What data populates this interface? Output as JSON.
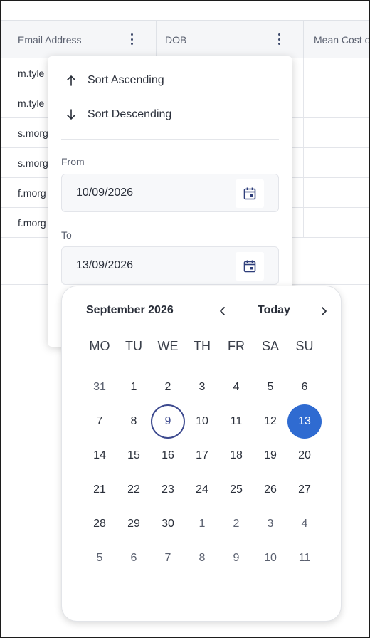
{
  "grid": {
    "columns": [
      {
        "label": "",
        "has_menu": false
      },
      {
        "label": "Email Address",
        "has_menu": true
      },
      {
        "label": "DOB",
        "has_menu": true
      },
      {
        "label": "Mean Cost o",
        "has_menu": false
      }
    ],
    "rows": [
      {
        "email": "m.tyle"
      },
      {
        "email": "m.tyle"
      },
      {
        "email": "s.morg"
      },
      {
        "email": "s.morg"
      },
      {
        "email": "f.morg"
      },
      {
        "email": "f.morg"
      }
    ]
  },
  "menu": {
    "sort_ascending": "Sort Ascending",
    "sort_descending": "Sort Descending",
    "from_label": "From",
    "from_value": "10/09/2026",
    "to_label": "To",
    "to_value": "13/09/2026"
  },
  "calendar": {
    "month_label": "September 2026",
    "today_label": "Today",
    "weekdays": [
      "MO",
      "TU",
      "WE",
      "TH",
      "FR",
      "SA",
      "SU"
    ],
    "weeks": [
      [
        {
          "d": "31",
          "muted": true
        },
        {
          "d": "1"
        },
        {
          "d": "2"
        },
        {
          "d": "3"
        },
        {
          "d": "4"
        },
        {
          "d": "5"
        },
        {
          "d": "6"
        }
      ],
      [
        {
          "d": "7"
        },
        {
          "d": "8"
        },
        {
          "d": "9",
          "today": true
        },
        {
          "d": "10"
        },
        {
          "d": "11"
        },
        {
          "d": "12"
        },
        {
          "d": "13",
          "selected": true
        }
      ],
      [
        {
          "d": "14"
        },
        {
          "d": "15"
        },
        {
          "d": "16"
        },
        {
          "d": "17"
        },
        {
          "d": "18"
        },
        {
          "d": "19"
        },
        {
          "d": "20"
        }
      ],
      [
        {
          "d": "21"
        },
        {
          "d": "22"
        },
        {
          "d": "23"
        },
        {
          "d": "24"
        },
        {
          "d": "25"
        },
        {
          "d": "26"
        },
        {
          "d": "27"
        }
      ],
      [
        {
          "d": "28"
        },
        {
          "d": "29"
        },
        {
          "d": "30"
        },
        {
          "d": "1",
          "muted": true
        },
        {
          "d": "2",
          "muted": true
        },
        {
          "d": "3",
          "muted": true
        },
        {
          "d": "4",
          "muted": true
        }
      ],
      [
        {
          "d": "5",
          "muted": true
        },
        {
          "d": "6",
          "muted": true
        },
        {
          "d": "7",
          "muted": true
        },
        {
          "d": "8",
          "muted": true
        },
        {
          "d": "9",
          "muted": true
        },
        {
          "d": "10",
          "muted": true
        },
        {
          "d": "11",
          "muted": true
        }
      ]
    ]
  },
  "colors": {
    "accent": "#2f6bd1",
    "today_ring": "#3d4a8f",
    "header_bg": "#f5f6f8"
  },
  "icons": {
    "sort_ascending": "arrow-up-icon",
    "sort_descending": "arrow-down-icon",
    "column_menu": "kebab-menu-icon",
    "date_picker": "calendar-icon",
    "prev_month": "chevron-left-icon",
    "next_month": "chevron-right-icon"
  }
}
